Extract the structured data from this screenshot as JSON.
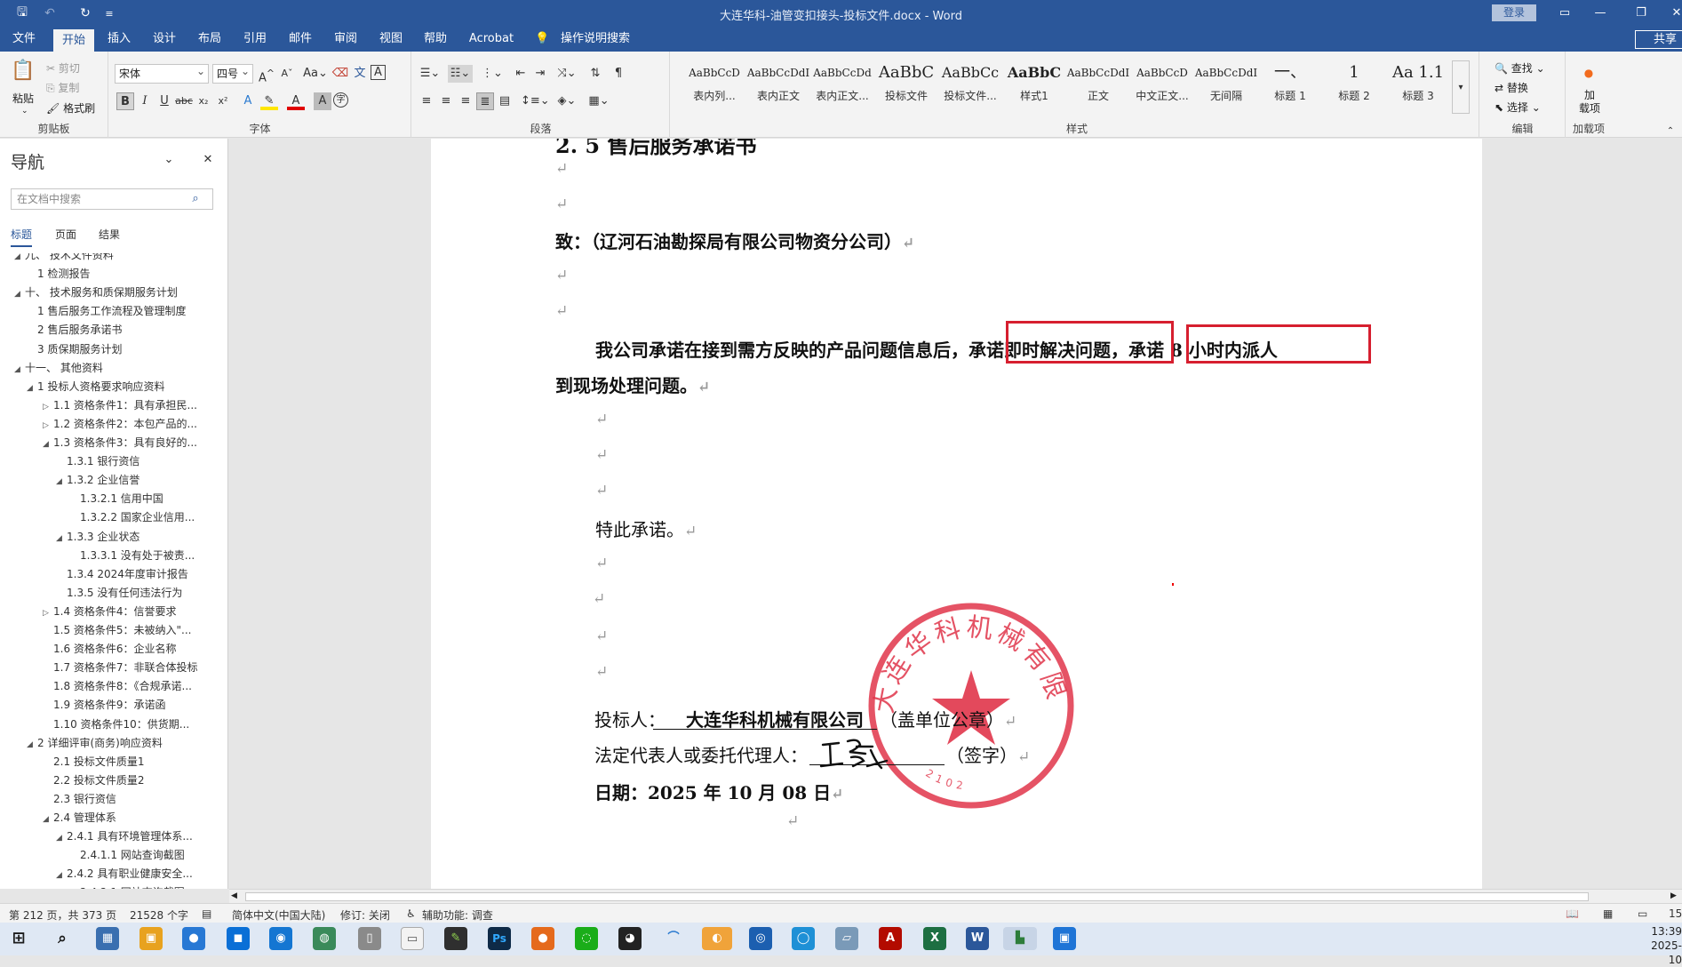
{
  "titlebar": {
    "title": "大连华科-油管变扣接头-投标文件.docx - Word",
    "login": "登录"
  },
  "tabs": [
    "文件",
    "开始",
    "插入",
    "设计",
    "布局",
    "引用",
    "邮件",
    "审阅",
    "视图",
    "帮助",
    "Acrobat",
    "操作说明搜索"
  ],
  "share": "共享",
  "ribbon": {
    "clipboard": {
      "paste": "粘贴",
      "cut": "剪切",
      "copy": "复制",
      "format_painter": "格式刷",
      "label": "剪贴板"
    },
    "font": {
      "name": "宋体",
      "size": "四号",
      "label": "字体"
    },
    "paragraph": {
      "label": "段落"
    },
    "styles": {
      "label": "样式",
      "items": [
        {
          "sample": "AaBbCcD",
          "name": "表内列..."
        },
        {
          "sample": "AaBbCcDdI",
          "name": "表内正文"
        },
        {
          "sample": "AaBbCcDd",
          "name": "表内正文..."
        },
        {
          "sample": "AaBbC",
          "name": "投标文件"
        },
        {
          "sample": "AaBbCc",
          "name": "投标文件..."
        },
        {
          "sample": "AaBbC",
          "name": "样式1"
        },
        {
          "sample": "AaBbCcDdI",
          "name": "正文"
        },
        {
          "sample": "AaBbCcD",
          "name": "中文正文..."
        },
        {
          "sample": "AaBbCcDdI",
          "name": "无间隔"
        },
        {
          "sample": "一、",
          "name": "标题 1"
        },
        {
          "sample": "1",
          "name": "标题 2"
        },
        {
          "sample": "Aa 1.1",
          "name": "标题 3"
        }
      ]
    },
    "editing": {
      "find": "查找",
      "replace": "替换",
      "select": "选择",
      "label": "编辑"
    },
    "addins": {
      "button": "加\n载项",
      "label": "加载项"
    }
  },
  "nav": {
    "title": "导航",
    "search_placeholder": "在文档中搜索",
    "tabs": [
      "标题",
      "页面",
      "结果"
    ],
    "items": [
      {
        "text": "九、 技术文件资料",
        "level": 1,
        "expander": "open"
      },
      {
        "text": "1 检测报告",
        "level": 2,
        "expander": "none"
      },
      {
        "text": "十、 技术服务和质保期服务计划",
        "level": 1,
        "expander": "open"
      },
      {
        "text": "1 售后服务工作流程及管理制度",
        "level": 2,
        "expander": "none"
      },
      {
        "text": "2 售后服务承诺书",
        "level": 2,
        "expander": "none"
      },
      {
        "text": "3 质保期服务计划",
        "level": 2,
        "expander": "none"
      },
      {
        "text": "十一、 其他资料",
        "level": 1,
        "expander": "open"
      },
      {
        "text": "1 投标人资格要求响应资料",
        "level": 2,
        "expander": "open"
      },
      {
        "text": "1.1 资格条件1：具有承担民...",
        "level": 3,
        "expander": "closed"
      },
      {
        "text": "1.2 资格条件2：本包产品的...",
        "level": 3,
        "expander": "closed"
      },
      {
        "text": "1.3 资格条件3：具有良好的...",
        "level": 3,
        "expander": "open"
      },
      {
        "text": "1.3.1 银行资信",
        "level": 4,
        "expander": "none"
      },
      {
        "text": "1.3.2 企业信誉",
        "level": 4,
        "expander": "open"
      },
      {
        "text": "1.3.2.1 信用中国",
        "level": 5,
        "expander": "none"
      },
      {
        "text": "1.3.2.2 国家企业信用...",
        "level": 5,
        "expander": "none"
      },
      {
        "text": "1.3.3 企业状态",
        "level": 4,
        "expander": "open"
      },
      {
        "text": "1.3.3.1 没有处于被责...",
        "level": 5,
        "expander": "none"
      },
      {
        "text": "1.3.4 2024年度审计报告",
        "level": 4,
        "expander": "none"
      },
      {
        "text": "1.3.5 没有任何违法行为",
        "level": 4,
        "expander": "none"
      },
      {
        "text": "1.4 资格条件4：信誉要求",
        "level": 3,
        "expander": "closed"
      },
      {
        "text": "1.5 资格条件5：未被纳入\"...",
        "level": 3,
        "expander": "none"
      },
      {
        "text": "1.6 资格条件6：企业名称",
        "level": 3,
        "expander": "none"
      },
      {
        "text": "1.7 资格条件7：非联合体投标",
        "level": 3,
        "expander": "none"
      },
      {
        "text": "1.8 资格条件8：《合规承诺...",
        "level": 3,
        "expander": "none"
      },
      {
        "text": "1.9 资格条件9：承诺函",
        "level": 3,
        "expander": "none"
      },
      {
        "text": "1.10 资格条件10：供货期...",
        "level": 3,
        "expander": "none"
      },
      {
        "text": "2 详细评审(商务)响应资料",
        "level": 2,
        "expander": "open"
      },
      {
        "text": "2.1 投标文件质量1",
        "level": 3,
        "expander": "none"
      },
      {
        "text": "2.2 投标文件质量2",
        "level": 3,
        "expander": "none"
      },
      {
        "text": "2.3 银行资信",
        "level": 3,
        "expander": "none"
      },
      {
        "text": "2.4 管理体系",
        "level": 3,
        "expander": "open"
      },
      {
        "text": "2.4.1 具有环境管理体系...",
        "level": 4,
        "expander": "open"
      },
      {
        "text": "2.4.1.1 网站查询截图",
        "level": 5,
        "expander": "none"
      },
      {
        "text": "2.4.2 具有职业健康安全...",
        "level": 4,
        "expander": "open"
      },
      {
        "text": "2.4.2.1 网站查询截图",
        "level": 5,
        "expander": "none"
      }
    ]
  },
  "document": {
    "heading_partial": "2. 5 售后服务承诺书",
    "to_line": "致：（辽河石油勘探局有限公司物资分公司）",
    "body_1a": "我公司承诺在接到需方反映的产品问题信息后，",
    "highlight_1": "承诺即时解决问题",
    "comma": "，",
    "highlight_2": "承诺 8 小时内派人",
    "body_2": "到现场处理问题。",
    "special": "特此承诺。",
    "bidder_label": "投标人：",
    "bidder_name": "大连华科机械有限公司",
    "bidder_suffix": "（盖单位公章）",
    "rep_label": "法定代表人或委托代理人：",
    "rep_suffix": "（签字）",
    "date": "日期：2025 年 10 月 08 日",
    "para_mark": "↵",
    "seal_text": "大连华科机械有限公司",
    "seal_code": "2102"
  },
  "status": {
    "page": "第 212 页，共 373 页",
    "words": "21528 个字",
    "language": "简体中文(中国大陆)",
    "track": "修订: 关闭",
    "accessibility": "辅助功能: 调查",
    "zoom_partial": "15"
  },
  "clock": {
    "time": "13:39",
    "date": "2025-10"
  },
  "colors": {
    "word_blue": "#2b579a",
    "highlight_red": "#d61f2f",
    "seal_red": "#e0354a"
  }
}
